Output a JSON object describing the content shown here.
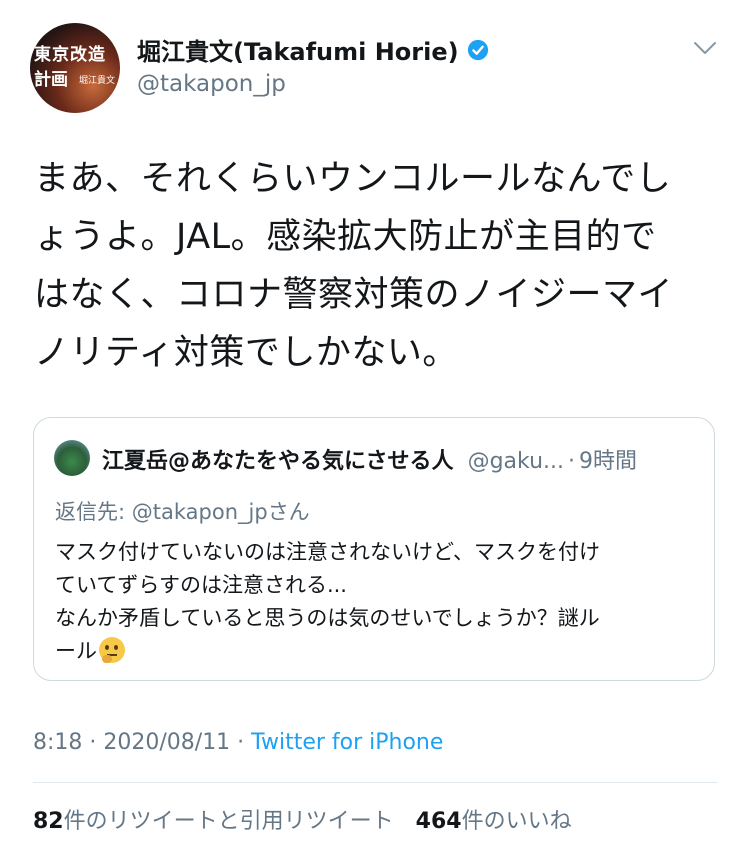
{
  "author": {
    "display_name": "堀江貴文(Takafumi Horie)",
    "handle": "@takapon_jp",
    "avatar_text_line1": "東京改造",
    "avatar_text_line2": "計画",
    "avatar_text_small": "堀江貴文",
    "verified_color": "#1da1f2"
  },
  "tweet": {
    "text": "まあ、それくらいウンコルールなんでし\nょうよ。JAL。感染拡大防止が主目的で\nはなく、コロナ警察対策のノイジーマイ\nノリティ対策でしかない。"
  },
  "quote": {
    "display_name": "江夏岳@あなたをやる気にさせる人",
    "handle": "@gaku...",
    "separator": "·",
    "time": "9時間",
    "reply_label": "返信先: ",
    "reply_mention": "@takapon_jp",
    "reply_suffix": "さん",
    "body": "マスク付けていないのは注意されないけど、マスクを付け\nていてずらすのは注意される...\nなんか矛盾していると思うのは気のせいでしょうか？謎ル\nール",
    "emoji": "thinking-face"
  },
  "meta": {
    "time": "8:18 · 2020/08/11 · ",
    "source": "Twitter for iPhone"
  },
  "stats": {
    "retweets": "82",
    "retweets_label": "件のリツイートと引用リツイート",
    "likes": "464",
    "likes_label": "件のいいね"
  },
  "colors": {
    "accent": "#1da1f2",
    "secondary_text": "#657786",
    "border": "#cfd9de"
  }
}
